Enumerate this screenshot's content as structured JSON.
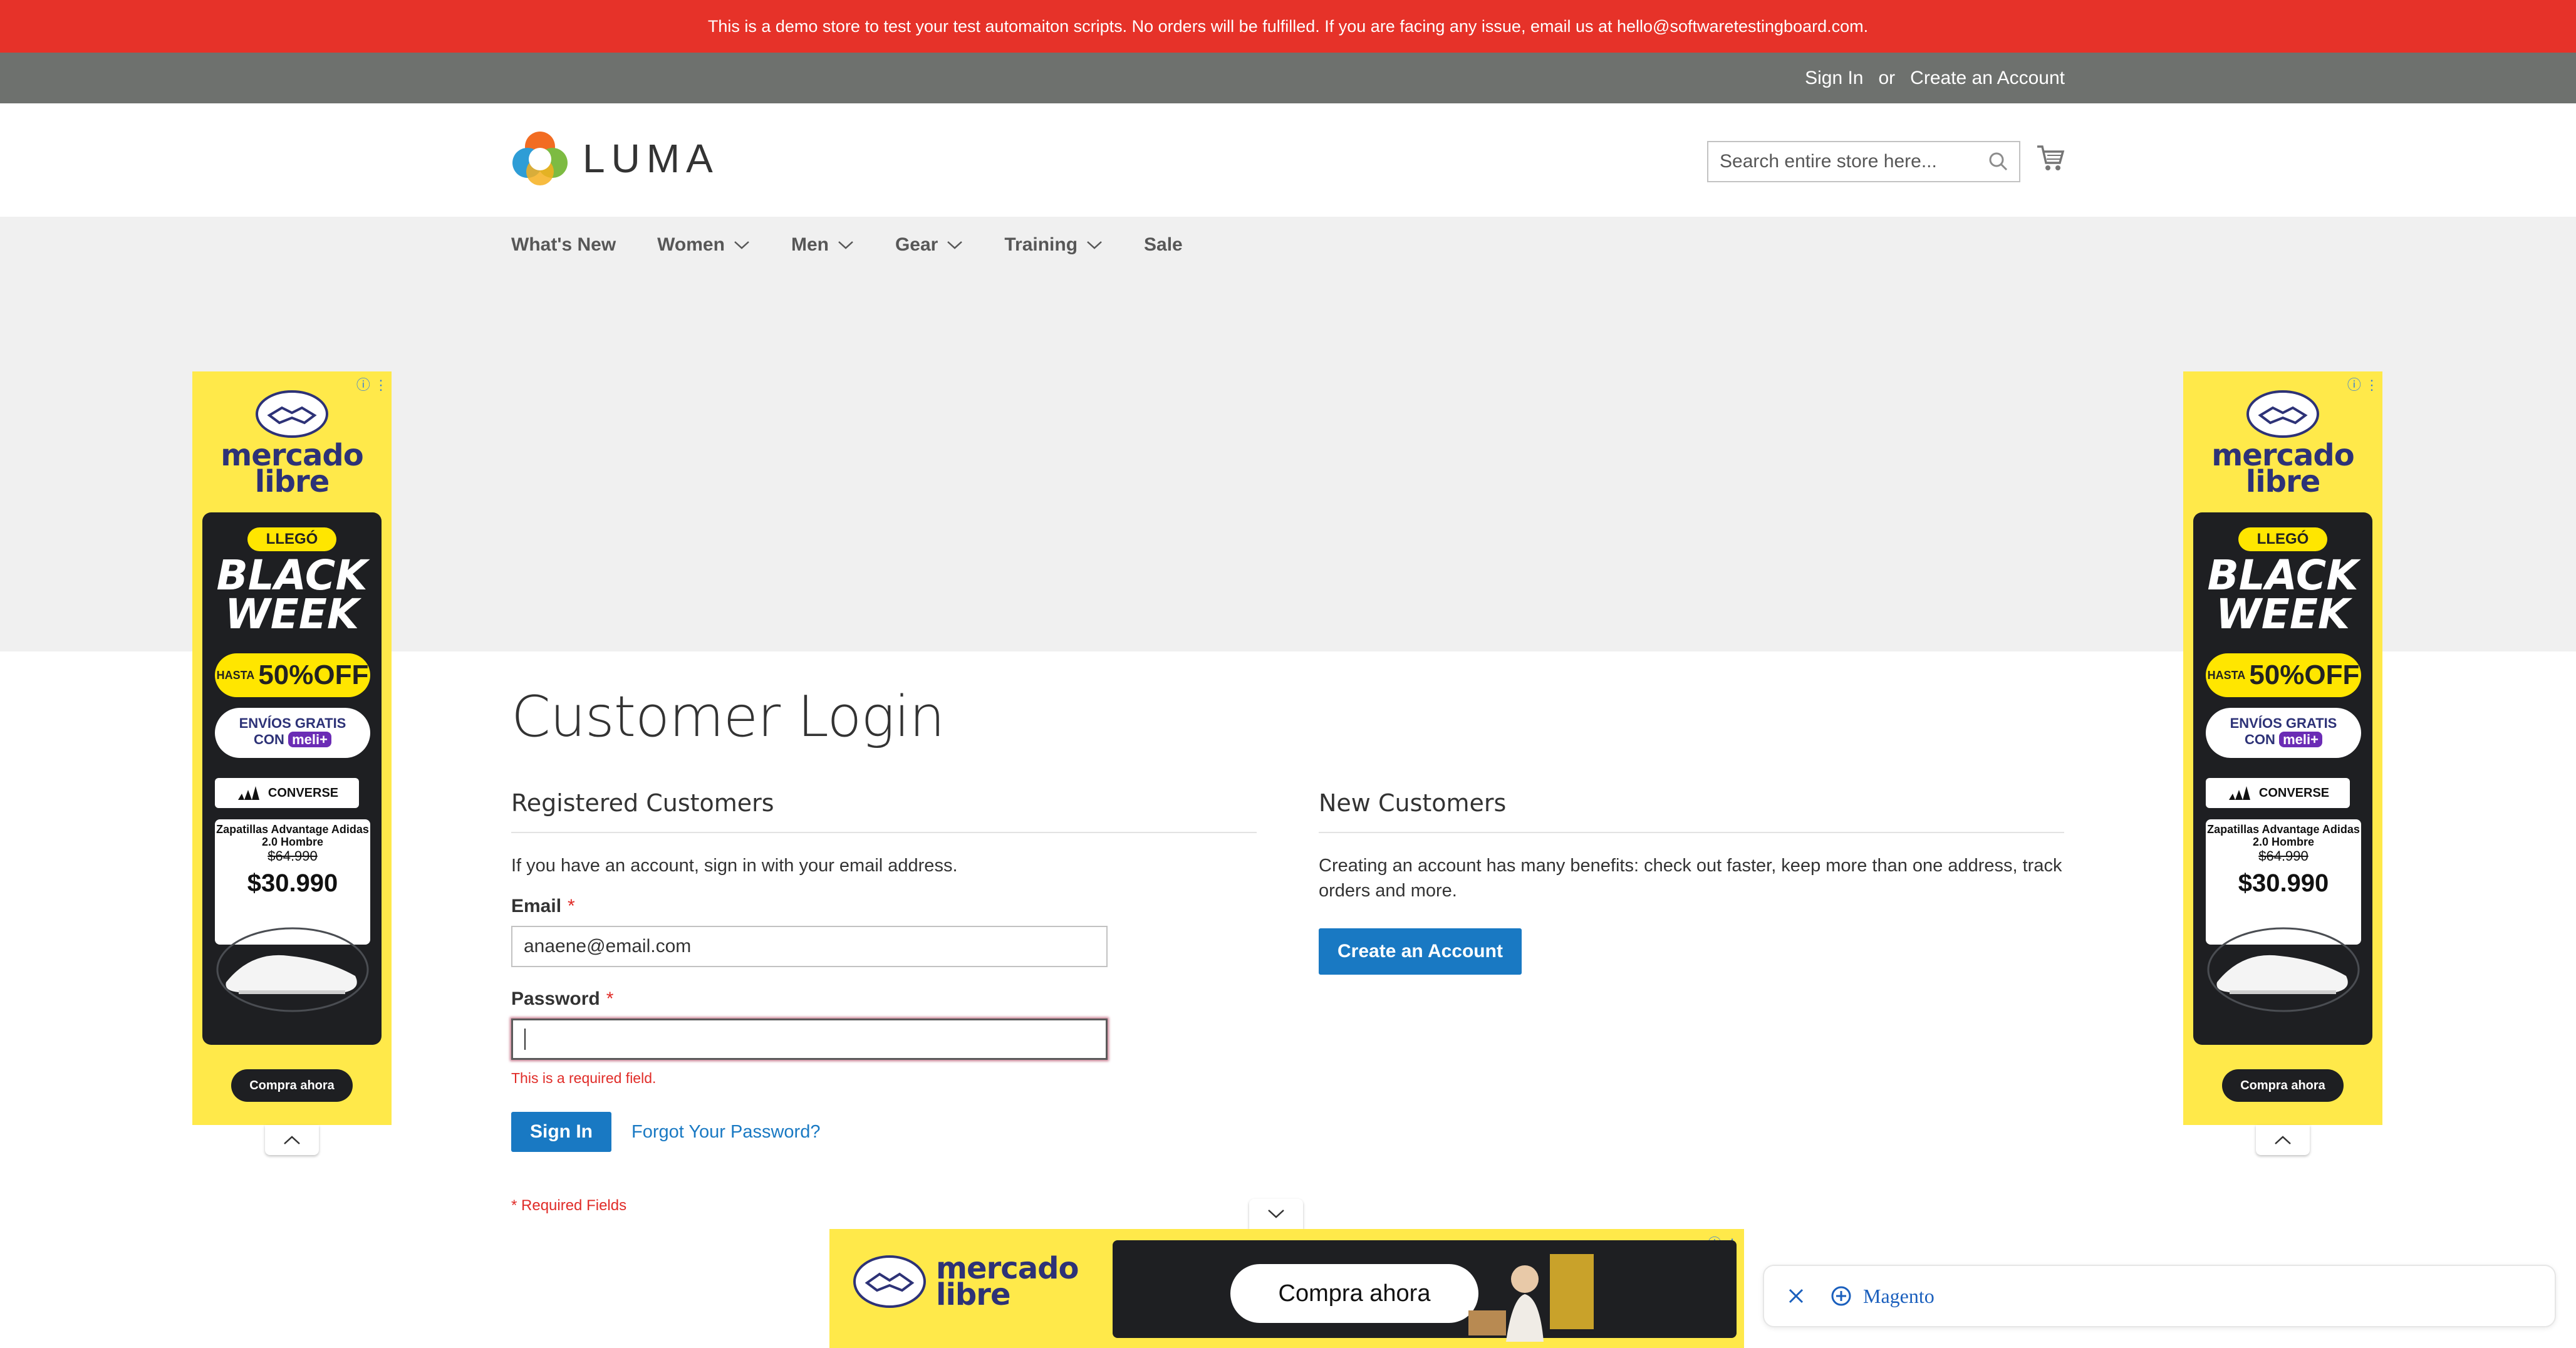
{
  "demo_banner": {
    "text": "This is a demo store to test your test automaiton scripts. No orders will be fulfilled. If you are facing any issue, email us at hello@softwaretestingboard.com."
  },
  "header_links": {
    "sign_in": "Sign In",
    "or": "or",
    "create_account": "Create an Account"
  },
  "logo": {
    "text": "LUMA"
  },
  "search": {
    "placeholder": "Search entire store here...",
    "value": ""
  },
  "nav": {
    "items": [
      {
        "label": "What's New",
        "has_dropdown": false
      },
      {
        "label": "Women",
        "has_dropdown": true
      },
      {
        "label": "Men",
        "has_dropdown": true
      },
      {
        "label": "Gear",
        "has_dropdown": true
      },
      {
        "label": "Training",
        "has_dropdown": true
      },
      {
        "label": "Sale",
        "has_dropdown": false
      }
    ]
  },
  "page": {
    "title": "Customer Login"
  },
  "registered": {
    "title": "Registered Customers",
    "intro": "If you have an account, sign in with your email address.",
    "email_label": "Email",
    "email_value": "anaene@email.com",
    "password_label": "Password",
    "password_value": "",
    "password_error": "This is a required field.",
    "sign_in_button": "Sign In",
    "forgot_link": "Forgot Your Password?",
    "required_note": "* Required Fields",
    "required_mark": "*"
  },
  "new_customers": {
    "title": "New Customers",
    "intro": "Creating an account has many benefits: check out faster, keep more than one address, track orders and more.",
    "create_button": "Create an Account"
  },
  "ad_vertical": {
    "brand_line1": "mercado",
    "brand_line2": "libre",
    "badge": "LLEGÓ",
    "headline1": "BLACK",
    "headline2": "WEEK",
    "hasta": "HASTA",
    "discount": "50%OFF",
    "envios_line1": "ENVÍOS GRATIS",
    "envios_line2": "CON",
    "meli_plus": "meli+",
    "brand_partner": "CONVERSE",
    "product_name": "Zapatillas Advantage Adidas 2.0 Hombre",
    "old_price": "$64.990",
    "price": "$30.990",
    "cta": "Compra ahora"
  },
  "ad_bottom": {
    "brand_line1": "mercado",
    "brand_line2": "libre",
    "cta": "Compra ahora"
  },
  "toast": {
    "label": "Magento"
  },
  "colors": {
    "banner_red": "#e63229",
    "panel_gray": "#6e716e",
    "link_blue": "#1979c3",
    "error_red": "#e02b27",
    "ad_yellow": "#ffe94a"
  }
}
